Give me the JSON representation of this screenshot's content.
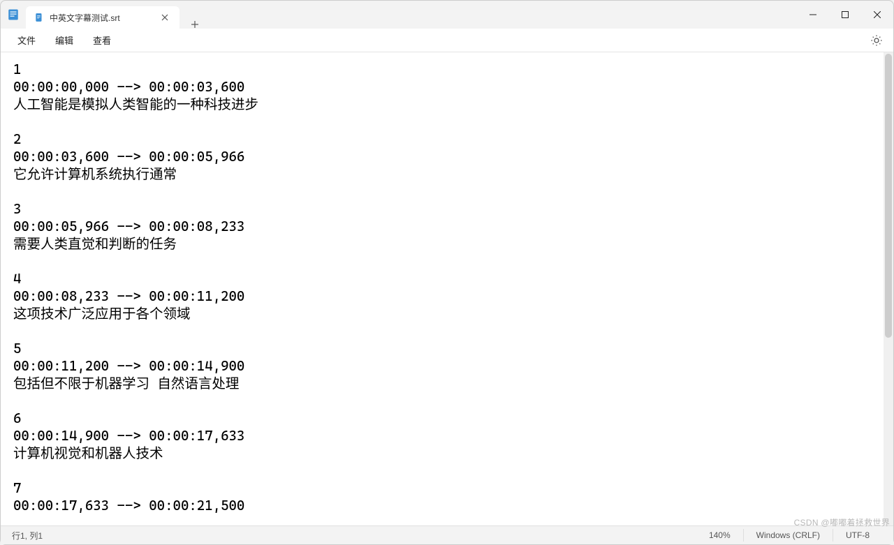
{
  "tab": {
    "title": "中英文字幕测试.srt"
  },
  "menubar": {
    "file": "文件",
    "edit": "编辑",
    "view": "查看"
  },
  "content": {
    "entries": [
      {
        "index": "1",
        "time": "00:00:00,000 --> 00:00:03,600",
        "text": "人工智能是模拟人类智能的一种科技进步"
      },
      {
        "index": "2",
        "time": "00:00:03,600 --> 00:00:05,966",
        "text": "它允许计算机系统执行通常"
      },
      {
        "index": "3",
        "time": "00:00:05,966 --> 00:00:08,233",
        "text": "需要人类直觉和判断的任务"
      },
      {
        "index": "4",
        "time": "00:00:08,233 --> 00:00:11,200",
        "text": "这项技术广泛应用于各个领域"
      },
      {
        "index": "5",
        "time": "00:00:11,200 --> 00:00:14,900",
        "text": "包括但不限于机器学习 自然语言处理"
      },
      {
        "index": "6",
        "time": "00:00:14,900 --> 00:00:17,633",
        "text": "计算机视觉和机器人技术"
      },
      {
        "index": "7",
        "time": "00:00:17,633 --> 00:00:21,500",
        "text": ""
      }
    ]
  },
  "statusbar": {
    "position": "行1, 列1",
    "zoom": "140%",
    "line_ending": "Windows (CRLF)",
    "encoding": "UTF-8"
  },
  "watermark": "CSDN @嘟嘟着拯救世界"
}
